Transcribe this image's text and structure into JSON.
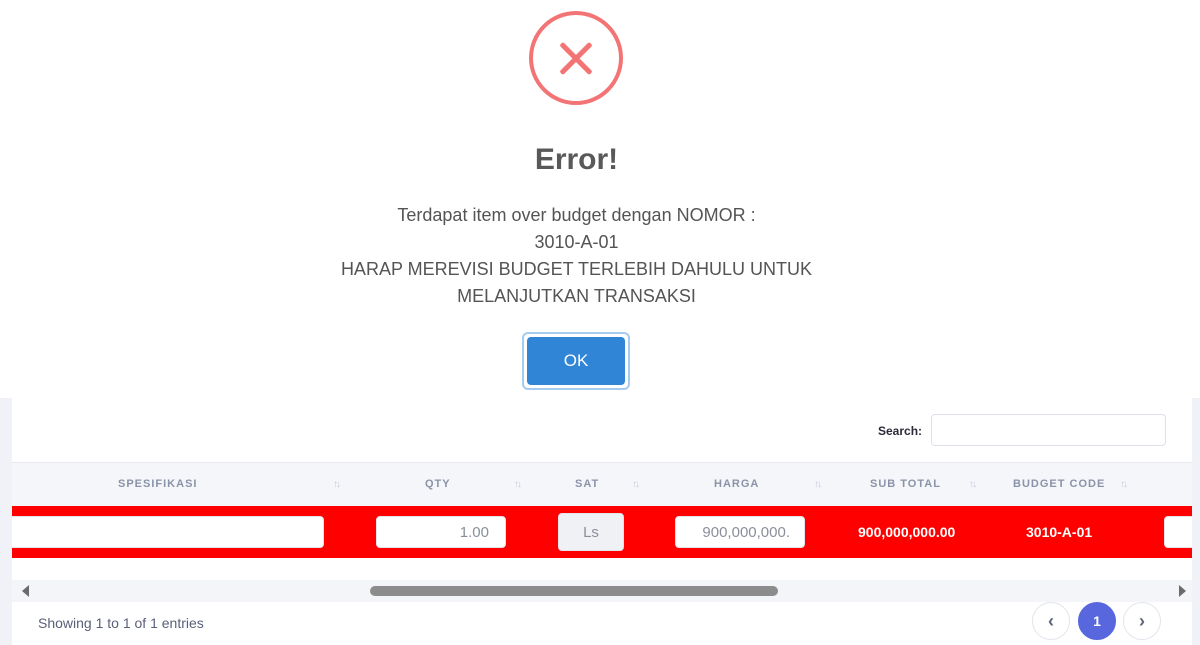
{
  "dialog": {
    "title": "Error!",
    "message_line1": "Terdapat item over budget dengan NOMOR :",
    "message_line2": "3010-A-01",
    "message_line3": "HARAP MEREVISI BUDGET TERLEBIH DAHULU UNTUK",
    "message_line4": "MELANJUTKAN TRANSAKSI",
    "ok_label": "OK",
    "icon": "error-x-icon",
    "icon_color": "#f27474",
    "button_color": "#3085d6"
  },
  "table": {
    "search_label": "Search:",
    "search_value": "",
    "columns": [
      "SPESIFIKASI",
      "QTY",
      "SAT",
      "HARGA",
      "SUB TOTAL",
      "BUDGET CODE"
    ],
    "row": {
      "spesifikasi": "",
      "qty": "1.00",
      "sat": "Ls",
      "harga": "900,000,000.",
      "sub_total": "900,000,000.00",
      "budget_code": "3010-A-01",
      "highlight_color": "#ff0000"
    },
    "info": "Showing 1 to 1 of 1 entries",
    "pagination": {
      "prev": "‹",
      "current": "1",
      "next": "›",
      "active_color": "#5867dd"
    }
  }
}
